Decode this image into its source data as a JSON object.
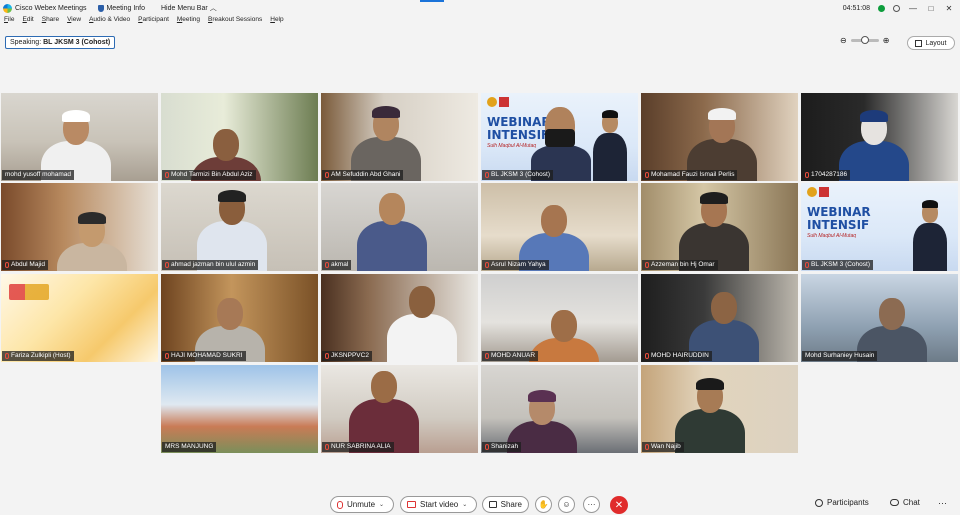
{
  "window": {
    "app_name": "Cisco Webex Meetings",
    "meeting_info": "Meeting Info",
    "hide_menu_bar": "Hide Menu Bar",
    "clock": "04:51:08"
  },
  "menu": [
    "File",
    "Edit",
    "Share",
    "View",
    "Audio & Video",
    "Participant",
    "Meeting",
    "Breakout Sessions",
    "Help"
  ],
  "speaking": {
    "label": "Speaking:",
    "name": "BL JKSM 3 (Cohost)"
  },
  "layout_button": "Layout",
  "tiles": [
    {
      "name": "mohd yusoff mohamad",
      "muted": false
    },
    {
      "name": "Mohd Tarmizi Bin Abdul Aziz",
      "muted": true
    },
    {
      "name": "AM Sefuddin Abd Ghani",
      "muted": true
    },
    {
      "name": "BL JKSM 3 (Cohost)",
      "muted": true,
      "active": true,
      "webinar": true
    },
    {
      "name": "Mohamad Fauzi Ismail Perlis",
      "muted": true
    },
    {
      "name": "1704287186",
      "muted": true
    },
    {
      "name": "Abdul Majid",
      "muted": true
    },
    {
      "name": "ahmad jazman bin ulul azmin",
      "muted": true
    },
    {
      "name": "akmal",
      "muted": true
    },
    {
      "name": "Asrul Nizam Yahya",
      "muted": true
    },
    {
      "name": "Azzeman bin Hj Omar",
      "muted": true
    },
    {
      "name": "BL JKSM 3 (Cohost)",
      "muted": true,
      "webinar": true
    },
    {
      "name": "Fariza Zulkipli (Host)",
      "muted": true
    },
    {
      "name": "HAJI MOHAMAD SUKRI",
      "muted": true
    },
    {
      "name": "JKSNPPVC2",
      "muted": true
    },
    {
      "name": "MOHD ANUAR",
      "muted": true
    },
    {
      "name": "MOHD HAIRUDDIN",
      "muted": true
    },
    {
      "name": "Mohd Surhaniey Husain",
      "muted": false
    },
    {
      "name": "MRS MANJUNG",
      "muted": false
    },
    {
      "name": "NUR SABRINA ALIA",
      "muted": true
    },
    {
      "name": "Shanizah",
      "muted": true
    },
    {
      "name": "Wan Najib",
      "muted": true
    }
  ],
  "webinar_banner": {
    "line1": "WEBINAR",
    "line2": "INTENSIF",
    "line3": "Sulh Maqbul Al-Mutaq"
  },
  "toolbar": {
    "unmute": "Unmute",
    "start_video": "Start video",
    "share": "Share",
    "participants": "Participants",
    "chat": "Chat",
    "more": "···"
  },
  "colors": {
    "accent": "#1a73d9",
    "leave": "#e02b2b",
    "muted_red": "#d33333"
  }
}
